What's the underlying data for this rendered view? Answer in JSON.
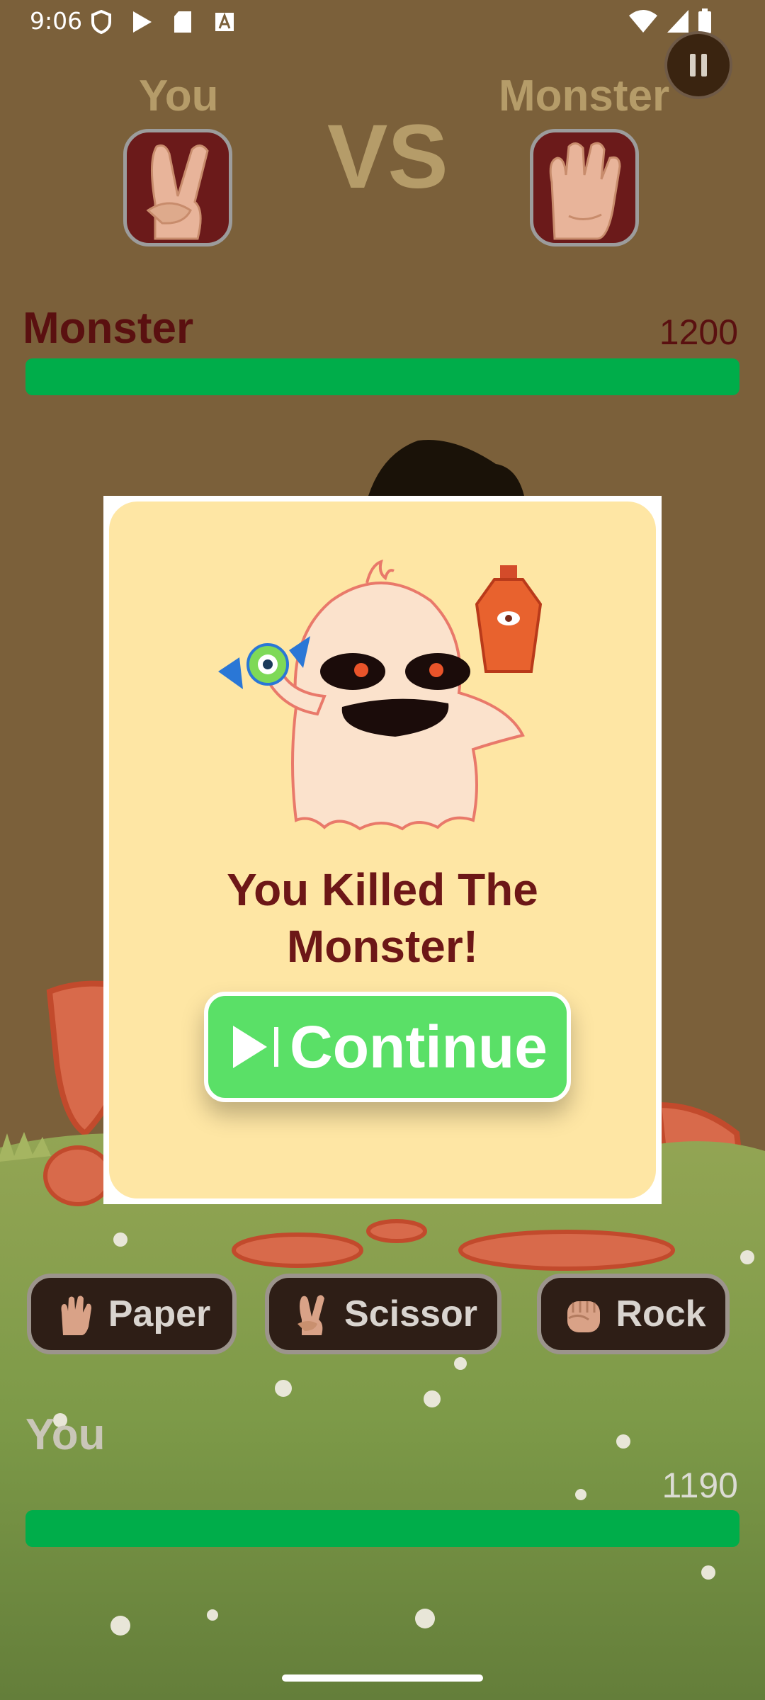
{
  "status_bar": {
    "time": "9:06",
    "icons": [
      "shield-icon",
      "play-store-icon",
      "sd-card-icon",
      "font-a-icon",
      "wifi-icon",
      "signal-icon",
      "battery-icon"
    ]
  },
  "header": {
    "player_label": "You",
    "vs_label": "VS",
    "monster_label": "Monster",
    "player_hand": "peace-hand-icon",
    "monster_hand": "open-hand-icon"
  },
  "monster_hp": {
    "name": "Monster",
    "value": "1200",
    "fill_fraction": 1.0,
    "bar_color": "#00AD4A"
  },
  "modal": {
    "title_line1": "You Killed The",
    "title_line2": "Monster!",
    "continue_label": "Continue",
    "button_color": "#5AE067",
    "card_color": "#FEE6A4"
  },
  "choices": [
    {
      "label": "Paper",
      "icon": "open-hand-icon"
    },
    {
      "label": "Scissor",
      "icon": "peace-hand-icon"
    },
    {
      "label": "Rock",
      "icon": "fist-icon"
    }
  ],
  "player_hp": {
    "name": "You",
    "value": "1190",
    "fill_fraction": 1.0,
    "bar_color": "#00AD4A"
  }
}
